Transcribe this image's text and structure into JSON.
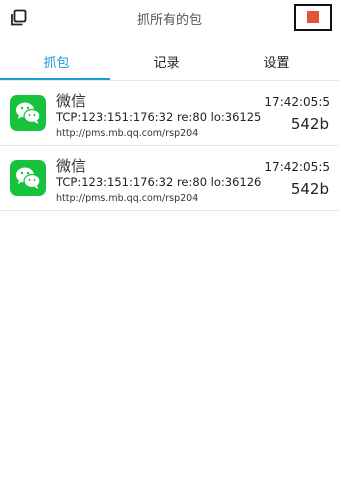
{
  "header": {
    "title": "抓所有的包",
    "copy_icon": "copy-icon",
    "stop_icon": "stop-square-icon",
    "stop_color": "#e35339"
  },
  "tabs": [
    {
      "label": "抓包",
      "active": true
    },
    {
      "label": "记录",
      "active": false
    },
    {
      "label": "设置",
      "active": false
    }
  ],
  "accent_color": "#1a9bd7",
  "packets": [
    {
      "app_name": "微信",
      "app_icon": "wechat-icon",
      "connection": "TCP:123:151:176:32 re:80 lo:36125",
      "url": "http://pms.mb.qq.com/rsp204",
      "time": "17:42:05:5",
      "size": "542b"
    },
    {
      "app_name": "微信",
      "app_icon": "wechat-icon",
      "connection": "TCP:123:151:176:32 re:80 lo:36126",
      "url": "http://pms.mb.qq.com/rsp204",
      "time": "17:42:05:5",
      "size": "542b"
    }
  ]
}
